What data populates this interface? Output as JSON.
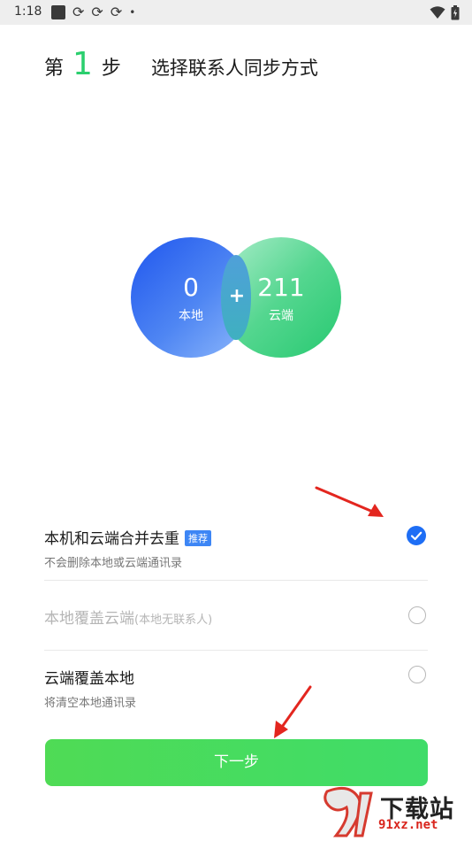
{
  "status_bar": {
    "time": "1:18"
  },
  "header": {
    "step_prefix": "第",
    "step_number": "1",
    "step_suffix": "步",
    "title": "选择联系人同步方式"
  },
  "venn": {
    "local_count": "0",
    "local_label": "本地",
    "cloud_count": "211",
    "cloud_label": "云端",
    "plus": "+"
  },
  "options": [
    {
      "title": "本机和云端合并去重",
      "badge": "推荐",
      "subtitle": "不会删除本地或云端通讯录",
      "selected": true,
      "enabled": true
    },
    {
      "title": "本地覆盖云端",
      "note": "(本地无联系人)",
      "selected": false,
      "enabled": false
    },
    {
      "title": "云端覆盖本地",
      "subtitle": "将清空本地通讯录",
      "selected": false,
      "enabled": true
    }
  ],
  "next_button": "下一步",
  "watermark": {
    "top": "下载站",
    "bottom": "91xz.net"
  },
  "colors": {
    "accent_green": "#2bcf6e",
    "selected_blue": "#1e6ef5",
    "button_green": "#44dc5e",
    "annotation_red": "#e3261f"
  }
}
